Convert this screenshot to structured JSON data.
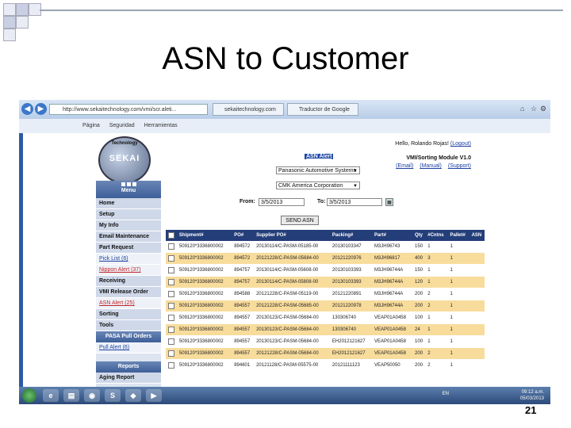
{
  "slide": {
    "title": "ASN to Customer",
    "number": "21"
  },
  "browser": {
    "address": "http://www.sekaitechnology.com/vmi/scr.aleti...",
    "tabs": [
      "sekaitechnology.com",
      "Traductor de Google"
    ],
    "toolbar": [
      "Página",
      "Seguridad",
      "Herramientas"
    ]
  },
  "app": {
    "logo_text": "SEKAI",
    "logo_arc": "Technology",
    "greeting": "Hello, Rolando Rojas!",
    "logout": "(Logout)",
    "module": "VMI/Sorting Module V1.0",
    "links": [
      "(Email)",
      "(Manual)",
      "(Support)"
    ]
  },
  "sidebar": {
    "menu_header": "Menu",
    "items": [
      {
        "label": "Home",
        "style": "item"
      },
      {
        "label": "Setup",
        "style": "item"
      },
      {
        "label": "My Info",
        "style": "item"
      },
      {
        "label": "Email Maintenance",
        "style": "item"
      },
      {
        "label": "Part Request",
        "style": "item"
      },
      {
        "label": "Pick List (6)",
        "style": "link"
      },
      {
        "label": "Nippon Alert (37)",
        "style": "red"
      },
      {
        "label": "Receiving",
        "style": "item"
      },
      {
        "label": "VMI Release Order",
        "style": "item"
      },
      {
        "label": "ASN Alert (25)",
        "style": "red"
      },
      {
        "label": "Sorting",
        "style": "item"
      },
      {
        "label": "Tools",
        "style": "item"
      }
    ],
    "pasa_header": "PASA Pull Orders",
    "pasa_items": [
      {
        "label": "Pull Alert (6)",
        "style": "link"
      }
    ],
    "reports_header": "Reports",
    "reports_items": [
      {
        "label": "Aging Report",
        "style": "item"
      }
    ]
  },
  "form": {
    "title": "ASN Alert",
    "customer": "Panasonic Automotive Systems",
    "supplier": "CMK America Corporation",
    "from_label": "From:",
    "from_value": "3/5/2013",
    "to_label": "To:",
    "to_value": "3/5/2013",
    "send_button": "SEND ASN"
  },
  "grid": {
    "columns": [
      "",
      "Shipment#",
      "PO#",
      "Supplier PO#",
      "Packing#",
      "Part#",
      "Qty",
      "#Cntns",
      "Pallet#",
      "ASN"
    ],
    "rows": [
      [
        "",
        "509120*3336800002",
        "894572",
        "20130114/C-PASM-05185-00",
        "20130103347",
        "M3JH96743",
        "150",
        "1",
        "1",
        ""
      ],
      [
        "",
        "509120*3336800002",
        "894572",
        "20121228/C-PASM-05684-00",
        "20121220976",
        "M3JH96817",
        "400",
        "3",
        "1",
        ""
      ],
      [
        "",
        "509120*3336800002",
        "894757",
        "20130114/C-PASM-05608-00",
        "20130103393",
        "M3JH96744A",
        "150",
        "1",
        "1",
        ""
      ],
      [
        "",
        "509120*3336800002",
        "894757",
        "20130114/C-PASM-05808-00",
        "20130103393",
        "M3JH96744A",
        "120",
        "1",
        "1",
        ""
      ],
      [
        "",
        "509120*3336800002",
        "894588",
        "20121228/C-PASM-05119-00",
        "20121220891",
        "M3JH96744A",
        "200",
        "2",
        "1",
        ""
      ],
      [
        "",
        "509120*3336800002",
        "894557",
        "20121228/C-PASM-05685-00",
        "20121220978",
        "M3JH96744A",
        "200",
        "2",
        "1",
        ""
      ],
      [
        "",
        "509120*3336800002",
        "894557",
        "20130123/C-PASM-05684-00",
        "130306740",
        "VEAP01A0458",
        "100",
        "1",
        "1",
        ""
      ],
      [
        "",
        "509120*3336800002",
        "894557",
        "20130123/C-PASM-05684-00",
        "130306740",
        "VEAP01A0458",
        "24",
        "1",
        "1",
        ""
      ],
      [
        "",
        "509120*3336800002",
        "894557",
        "20130123/C-PASM-05684-00",
        "EH2012121627",
        "VEAP01A0458",
        "100",
        "1",
        "1",
        ""
      ],
      [
        "",
        "509120*3336800002",
        "894557",
        "20121228/C-PASM-05684-00",
        "EH2012121627",
        "VEAP01A0458",
        "200",
        "2",
        "1",
        ""
      ],
      [
        "",
        "509120*3336800002",
        "894601",
        "20121128/C-PASM-05575-00",
        "20121111123",
        "VEAP50050",
        "200",
        "2",
        "1",
        ""
      ]
    ]
  },
  "taskbar": {
    "icons": [
      "e",
      "▤",
      "◉",
      "S",
      "◆",
      "▶"
    ],
    "lang": "EN",
    "time": "09:12 a.m.",
    "date": "05/03/2013"
  }
}
